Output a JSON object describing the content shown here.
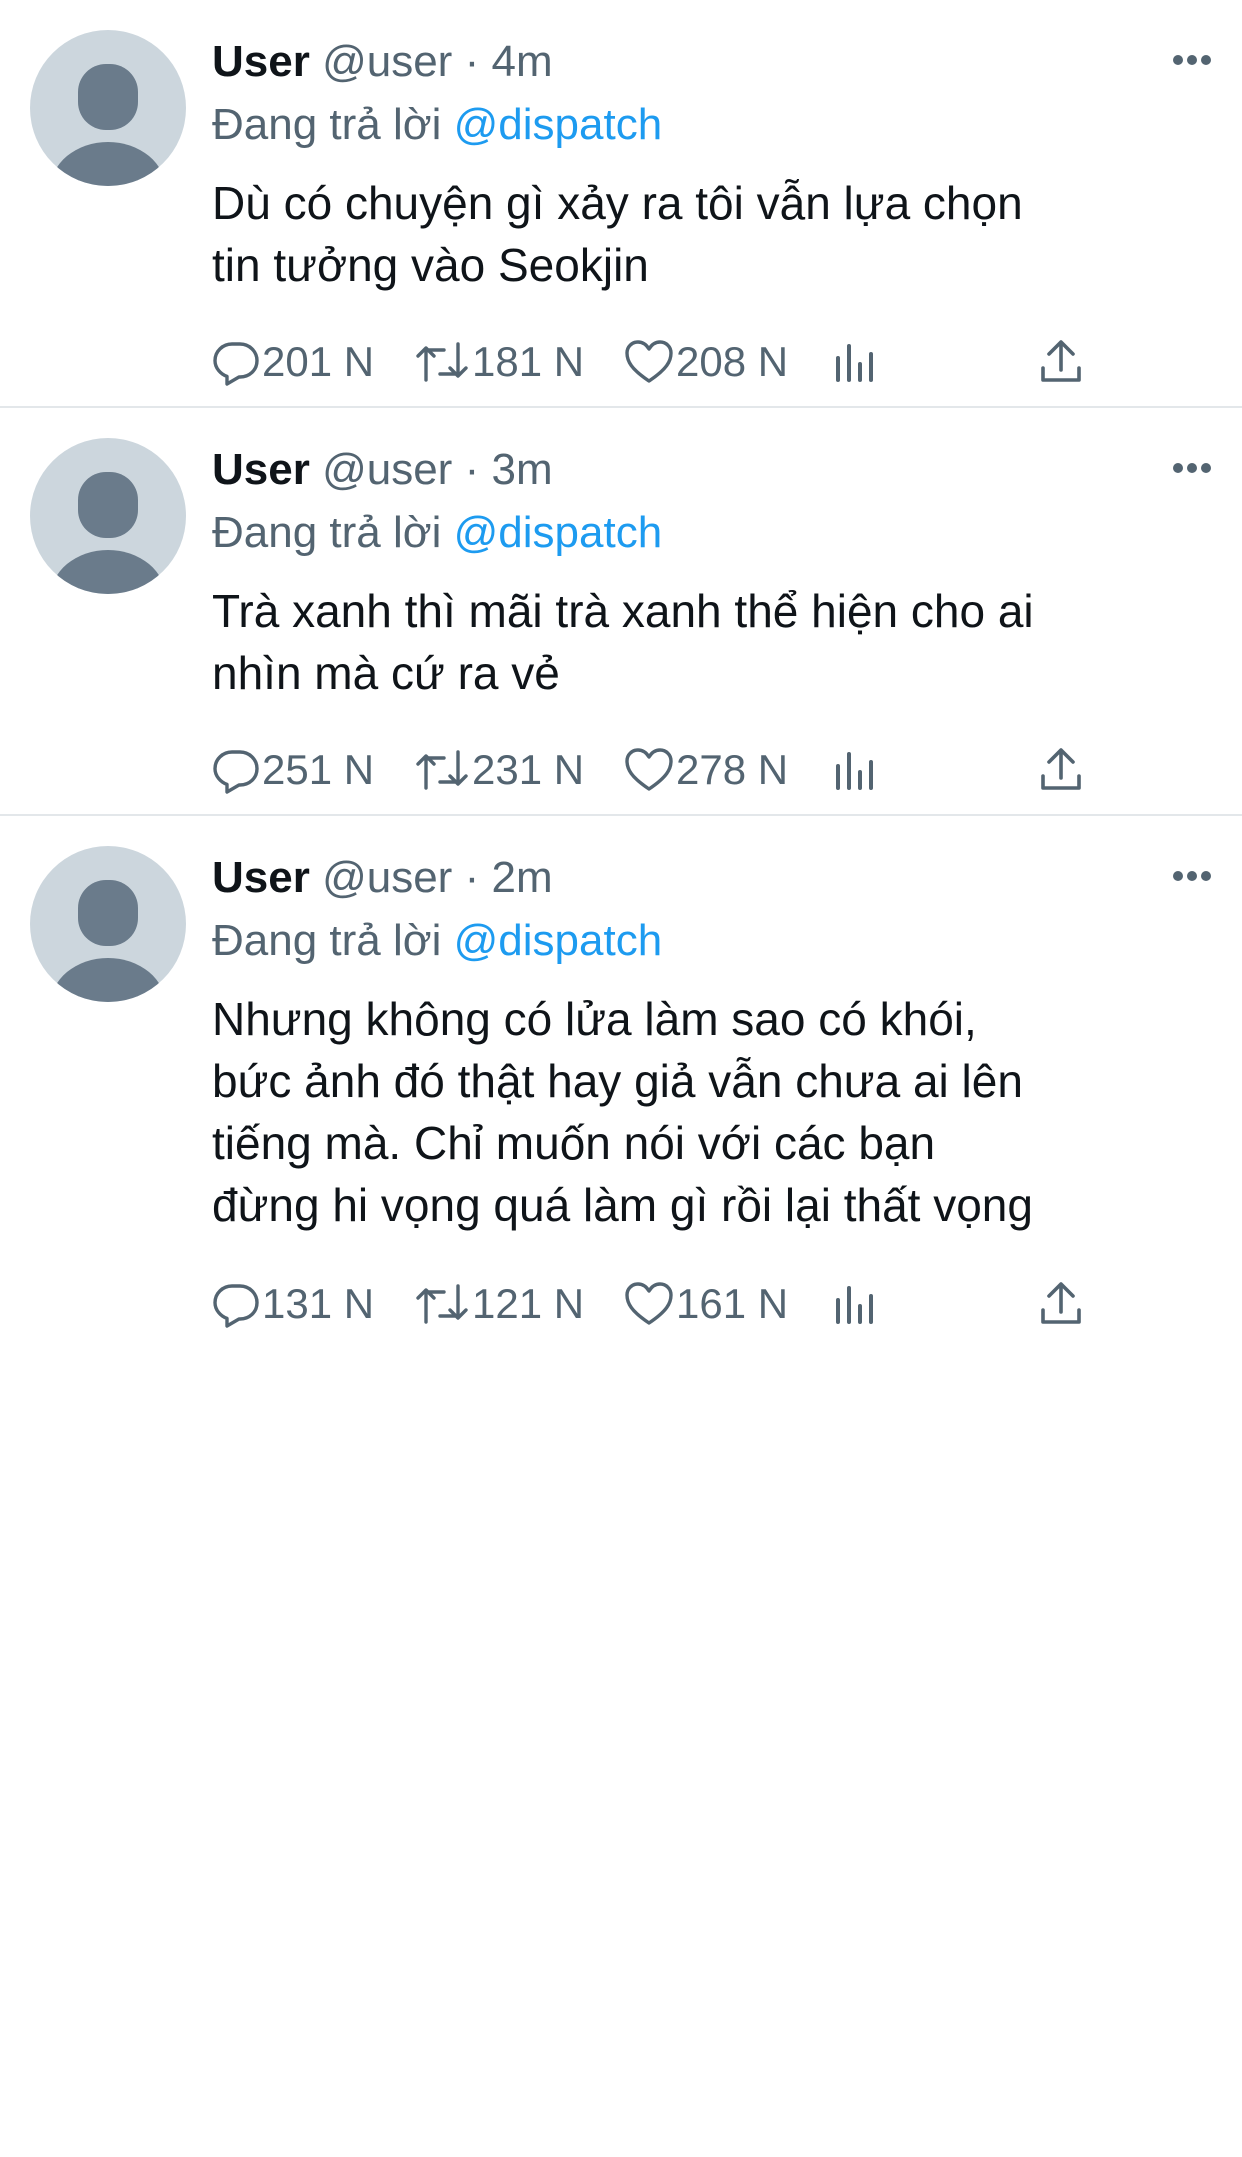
{
  "tweets": [
    {
      "name": "User",
      "handle": "@user",
      "dot": "·",
      "time": "4m",
      "reply_prefix": "Đang trả lời",
      "reply_mention": "@dispatch",
      "text": "Dù có chuyện gì xảy ra tôi vẫn lựa chọn\ntin tưởng vào Seokjin",
      "replies": "201 N",
      "retweets": "181 N",
      "likes": "208 N"
    },
    {
      "name": "User",
      "handle": "@user",
      "dot": "·",
      "time": "3m",
      "reply_prefix": "Đang trả lời",
      "reply_mention": "@dispatch",
      "text": "Trà xanh thì mãi trà xanh thể hiện cho ai\nnhìn mà cứ ra vẻ",
      "replies": "251 N",
      "retweets": "231 N",
      "likes": "278 N"
    },
    {
      "name": "User",
      "handle": "@user",
      "dot": "·",
      "time": "2m",
      "reply_prefix": "Đang trả lời",
      "reply_mention": "@dispatch",
      "text": "Nhưng không có lửa làm sao có khói,\nbức ảnh đó thật hay giả vẫn chưa ai lên\ntiếng mà. Chỉ muốn nói với các bạn\nđừng hi vọng quá làm gì rồi lại thất vọng",
      "replies": "131 N",
      "retweets": "121 N",
      "likes": "161 N"
    }
  ],
  "icons": {
    "more": "more-icon",
    "reply": "reply-icon",
    "retweet": "retweet-icon",
    "like": "heart-icon",
    "analytics": "analytics-icon",
    "share": "share-icon"
  },
  "colors": {
    "text": "#0f1419",
    "secondary": "#536471",
    "mention": "#1d9bf0",
    "avatar_bg": "#ccd6dd",
    "avatar_fg": "#6a7b8b",
    "divider": "#e3e7ea"
  }
}
